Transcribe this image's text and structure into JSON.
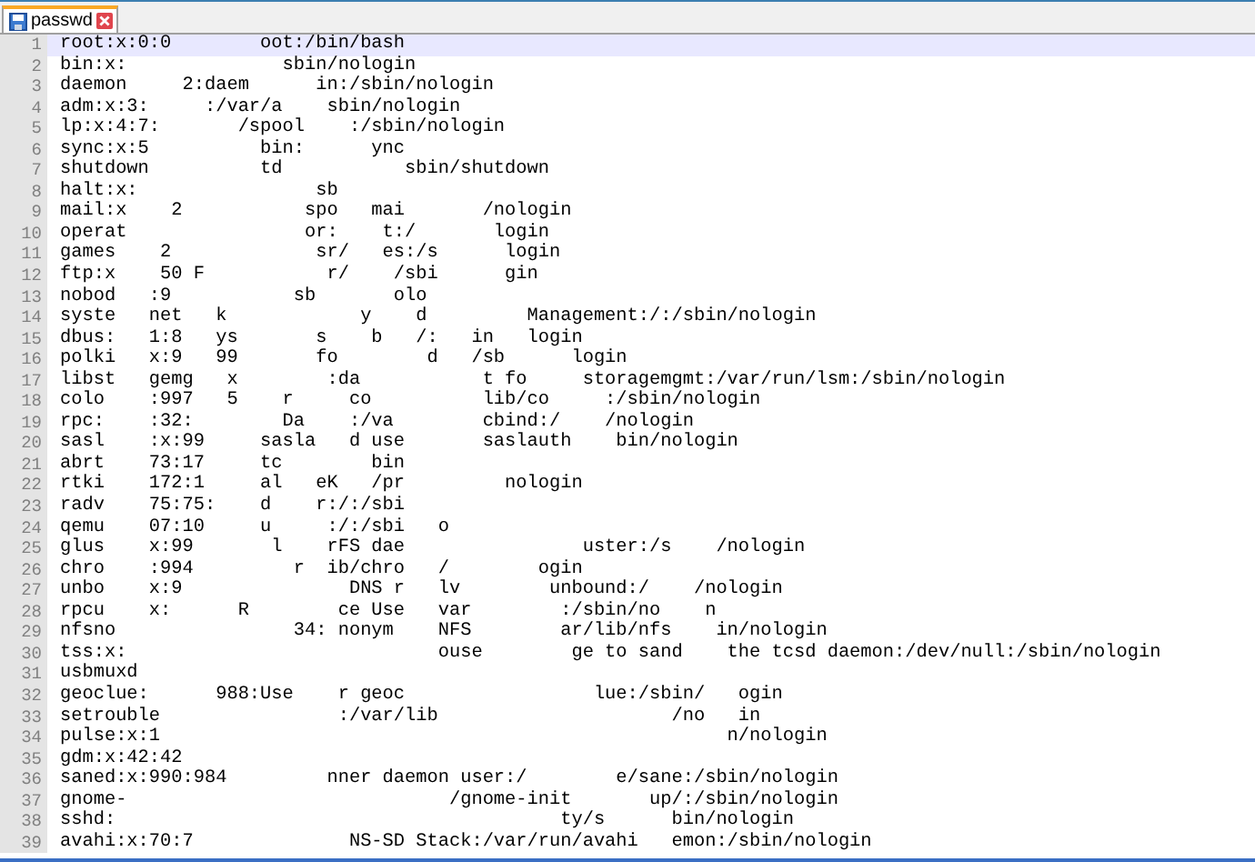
{
  "tabs": [
    {
      "label": "passwd",
      "selected": true
    }
  ],
  "lines": [
    {
      "number": "1",
      "text": "root:x:0:0        oot:/bin/bash",
      "selected": true
    },
    {
      "number": "2",
      "text": "bin:x:              sbin/nologin",
      "selected": false
    },
    {
      "number": "3",
      "text": "daemon     2:daem      in:/sbin/nologin",
      "selected": false
    },
    {
      "number": "4",
      "text": "adm:x:3:     :/var/a    sbin/nologin",
      "selected": false
    },
    {
      "number": "5",
      "text": "lp:x:4:7:       /spool    :/sbin/nologin",
      "selected": false
    },
    {
      "number": "6",
      "text": "sync:x:5          bin:      ync",
      "selected": false
    },
    {
      "number": "7",
      "text": "shutdown          td           sbin/shutdown",
      "selected": false
    },
    {
      "number": "8",
      "text": "halt:x:                sb",
      "selected": false
    },
    {
      "number": "9",
      "text": "mail:x    2           spo   mai       /nologin",
      "selected": false
    },
    {
      "number": "10",
      "text": "operat                or:    t:/       login",
      "selected": false
    },
    {
      "number": "11",
      "text": "games    2             sr/   es:/s      login",
      "selected": false
    },
    {
      "number": "12",
      "text": "ftp:x    50 F           r/    /sbi      gin",
      "selected": false
    },
    {
      "number": "13",
      "text": "nobod   :9           sb       olo",
      "selected": false
    },
    {
      "number": "14",
      "text": "syste   net   k            y    d         Management:/:/sbin/nologin",
      "selected": false
    },
    {
      "number": "15",
      "text": "dbus:   1:8   ys       s    b   /:   in   login",
      "selected": false
    },
    {
      "number": "16",
      "text": "polki   x:9   99       fo        d   /sb      login",
      "selected": false
    },
    {
      "number": "17",
      "text": "libst   gemg   x        :da           t fo     storagemgmt:/var/run/lsm:/sbin/nologin",
      "selected": false
    },
    {
      "number": "18",
      "text": "colo    :997   5    r     co          lib/co     :/sbin/nologin",
      "selected": false
    },
    {
      "number": "19",
      "text": "rpc:    :32:        Da    :/va        cbind:/    /nologin",
      "selected": false
    },
    {
      "number": "20",
      "text": "sasl    :x:99     sasla   d use       saslauth    bin/nologin",
      "selected": false
    },
    {
      "number": "21",
      "text": "abrt    73:17     tc        bin",
      "selected": false
    },
    {
      "number": "22",
      "text": "rtki    172:1     al   eK   /pr         nologin",
      "selected": false
    },
    {
      "number": "23",
      "text": "radv    75:75:    d    r:/:/sbi",
      "selected": false
    },
    {
      "number": "24",
      "text": "qemu    07:10     u     :/:/sbi   o",
      "selected": false
    },
    {
      "number": "25",
      "text": "glus    x:99       l    rFS dae                uster:/s    /nologin",
      "selected": false
    },
    {
      "number": "26",
      "text": "chro    :994         r  ib/chro   /        ogin",
      "selected": false
    },
    {
      "number": "27",
      "text": "unbo    x:9               DNS r   lv        unbound:/    /nologin",
      "selected": false
    },
    {
      "number": "28",
      "text": "rpcu    x:      R        ce Use   var        :/sbin/no    n",
      "selected": false
    },
    {
      "number": "29",
      "text": "nfsno                34: nonym    NFS        ar/lib/nfs    in/nologin",
      "selected": false
    },
    {
      "number": "30",
      "text": "tss:x:                            ouse        ge to sand    the tcsd daemon:/dev/null:/sbin/nologin",
      "selected": false
    },
    {
      "number": "31",
      "text": "usbmuxd",
      "selected": false
    },
    {
      "number": "32",
      "text": "geoclue:      988:Use    r geoc                 lue:/sbin/   ogin",
      "selected": false
    },
    {
      "number": "33",
      "text": "setrouble                :/var/lib                     /no   in",
      "selected": false
    },
    {
      "number": "34",
      "text": "pulse:x:1                                                   n/nologin",
      "selected": false
    },
    {
      "number": "35",
      "text": "gdm:x:42:42",
      "selected": false
    },
    {
      "number": "36",
      "text": "saned:x:990:984         nner daemon user:/        e/sane:/sbin/nologin",
      "selected": false
    },
    {
      "number": "37",
      "text": "gnome-                             /gnome-init       up/:/sbin/nologin",
      "selected": false
    },
    {
      "number": "38",
      "text": "sshd:                                        ty/s      bin/nologin",
      "selected": false
    },
    {
      "number": "39",
      "text": "avahi:x:70:7              NS-SD Stack:/var/run/avahi   emon:/sbin/nologin",
      "selected": false
    }
  ]
}
